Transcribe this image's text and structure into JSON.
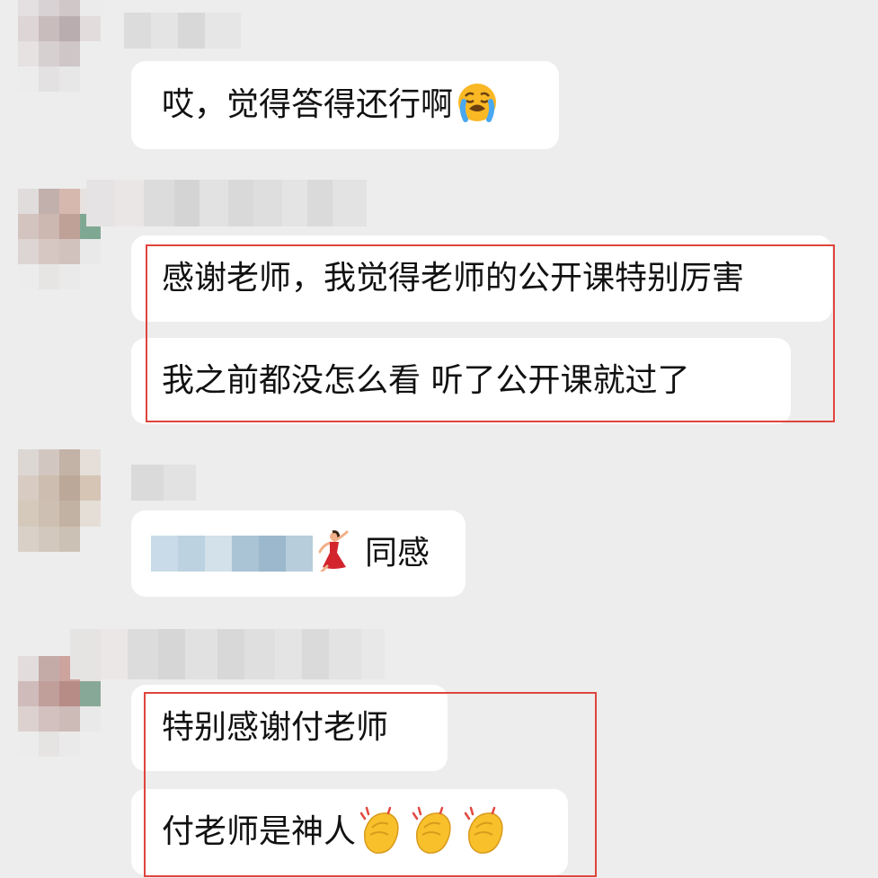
{
  "colors": {
    "background": "#ededed",
    "bubble": "#ffffff",
    "highlight_box": "#e0443e",
    "text": "#111111"
  },
  "messages": [
    {
      "sender": "hidden",
      "text": "哎，觉得答得还行啊",
      "emoji": "loudly-crying-face"
    },
    {
      "sender": "hidden",
      "text": "感谢老师，我觉得老师的公开课特别厉害"
    },
    {
      "sender": "hidden",
      "text": "我之前都没怎么看 听了公开课就过了"
    },
    {
      "sender": "hidden",
      "text": "同感",
      "prefix": "pixelated-content",
      "emoji": "dancing-woman"
    },
    {
      "sender": "hidden",
      "text": "特别感谢付老师"
    },
    {
      "sender": "hidden",
      "text": "付老师是神人",
      "emoji": "clapping-hands"
    }
  ]
}
